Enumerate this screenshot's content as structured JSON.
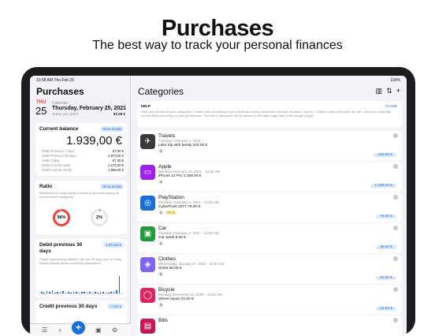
{
  "hero": {
    "title": "Purchases",
    "subtitle": "The best way to track your personal finances"
  },
  "status": {
    "time": "10:58 AM   Thu Feb 25",
    "battery": "100%"
  },
  "sidebar": {
    "title": "Purchases",
    "date": {
      "dow": "THU",
      "day": "25",
      "caption": "Calendar",
      "full": "Thursday, February 25, 2021",
      "spent_label": "Today you spent:",
      "spent_value": "87,00 €"
    },
    "balance": {
      "title": "Current balance",
      "pill": "Show details",
      "value": "1.939,00 €",
      "rows": [
        {
          "label": "- Debit Previous 7 days",
          "value": "87,00 €"
        },
        {
          "label": "- Debit Previous 30 days",
          "value": "1.873,00 €"
        },
        {
          "label": "- Debit Today",
          "value": "87,00 €"
        },
        {
          "label": "- Debit Current week",
          "value": "1.276,00 €"
        },
        {
          "label": "- Debit Current month",
          "value": "1.895,00 €"
        }
      ]
    },
    "ratio": {
      "title": "Ratio",
      "pill": "Show details",
      "desc": "Breakdown of outgoing and incoming amounts among all non-archived categories.",
      "left": "98%",
      "right": "2%",
      "left_fraction": 0.98,
      "right_fraction": 0.02
    },
    "debit30": {
      "title": "Debit previous 30 days",
      "pill": "1.873,00 €",
      "desc": "Graph representing debits in the last 30 days prior to today. Values include all non-archived transactions."
    },
    "credit30": {
      "title": "Credit previous 30 days",
      "pill": "+ 0,00 €"
    }
  },
  "tabbar": {
    "items": [
      {
        "name": "list-icon",
        "glyph": "☰"
      },
      {
        "name": "search-icon",
        "glyph": "⌕"
      },
      {
        "name": "add-icon",
        "glyph": "+"
      },
      {
        "name": "archive-icon",
        "glyph": "▣"
      },
      {
        "name": "settings-icon",
        "glyph": "⚙"
      }
    ]
  },
  "main": {
    "title": "Categories",
    "help": {
      "title": "HELP",
      "close": "CLOSE",
      "text": "Here you will see all your categories. Create them according to your habits and every transaction will have its place. Tap the + button to add new ones, tap the + button to manually reorder them according to your preferences. The first 4 categories will be shown on the main page and on the widget (large)"
    },
    "categories": [
      {
        "name": "Travels",
        "date": "Tuesday, February 2, 2021",
        "item": "Lake trip with family   240,00 €",
        "count": "1",
        "total": "240,00 €",
        "color": "#3a3a3c",
        "icon": "✈"
      },
      {
        "name": "Apple",
        "date": "Monday, February 22, 2021 - 10:32 AM",
        "item": "iPhone 12 Pro   1.189,00 €",
        "count": "1",
        "total": "1.189,00 €",
        "color": "#a020f0",
        "icon": "▭"
      },
      {
        "name": "PlayStation",
        "date": "Tuesday, February 2, 2021 - 10:53 AM",
        "item": "CyberPunk 2077   79,00 €",
        "count": "1",
        "pct": "79 %",
        "total": "79,00 €",
        "color": "#1a6fd8",
        "icon": "◎"
      },
      {
        "name": "Car",
        "date": "Tuesday, February 2, 2021 - 10:53 AM",
        "item": "Car wash   8,00 €",
        "count": "1",
        "total": "38,00 €",
        "color": "#1f9d3a",
        "icon": "▣"
      },
      {
        "name": "Clothes",
        "date": "Wednesday, January 27, 2021 - 10:54 AM",
        "item": "Shirts   66,00 €",
        "count": "2",
        "total": "22,00 €",
        "color": "#7b68ee",
        "icon": "◈"
      },
      {
        "name": "Bicycle",
        "date": "Monday, December 21, 2020 - 10:53 AM",
        "item": "Wheel repair   22,00 €",
        "count": "1",
        "total": "22,00 €",
        "color": "#e0245e",
        "icon": "◯"
      },
      {
        "name": "Bills",
        "date": "",
        "item": "",
        "count": "",
        "total": "",
        "color": "#c2185b",
        "icon": "▤"
      }
    ]
  },
  "chart_data": {
    "type": "bar",
    "title": "Debit previous 30 days",
    "values": [
      0.1,
      0.05,
      0.15,
      0.1,
      0.2,
      0.05,
      0.1,
      0.08,
      0.12,
      0.05,
      0.1,
      0.06,
      0.08,
      0.1,
      0.05,
      0.07,
      0.1,
      0.05,
      0.08,
      0.06,
      0.1,
      0.05,
      0.08,
      0.1,
      0.06,
      0.05,
      0.08,
      0.1,
      0.2,
      1.0
    ]
  }
}
